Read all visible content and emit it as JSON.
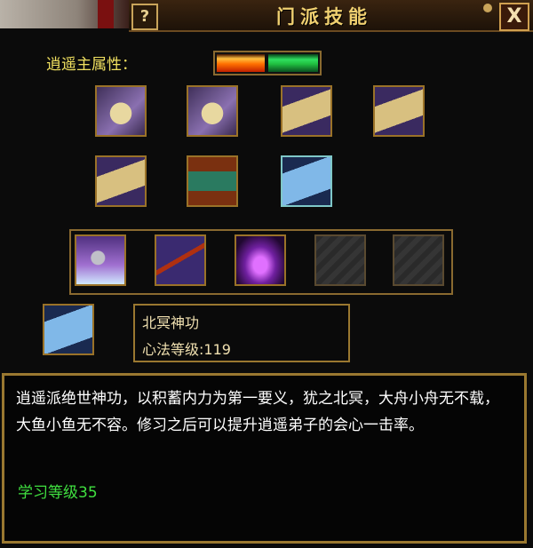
{
  "window": {
    "title": "门派技能",
    "help_label": "?",
    "close_label": "X"
  },
  "attribute": {
    "label": "逍遥主属性："
  },
  "skills_row1": [
    {
      "name": "skill-book-1",
      "type": "book"
    },
    {
      "name": "skill-book-2",
      "type": "book"
    },
    {
      "name": "skill-scroll-bamboo",
      "type": "scroll"
    },
    {
      "name": "skill-scroll-4",
      "type": "scroll"
    }
  ],
  "skills_row2": [
    {
      "name": "skill-scroll-5",
      "type": "scroll"
    },
    {
      "name": "skill-chest",
      "type": "chest"
    },
    {
      "name": "skill-blue-scroll",
      "type": "bluescroll",
      "selected": true
    }
  ],
  "skills_row3": [
    {
      "name": "martial-skill-wave",
      "type": "wave"
    },
    {
      "name": "martial-skill-spear",
      "type": "spear"
    },
    {
      "name": "martial-skill-purple",
      "type": "purple"
    },
    {
      "name": "martial-skill-locked-1",
      "type": "locked"
    },
    {
      "name": "martial-skill-locked-2",
      "type": "locked"
    }
  ],
  "detail": {
    "name": "北冥神功",
    "level_text": "心法等级:119"
  },
  "description": {
    "text": "逍遥派绝世神功，以积蓄内力为第一要义，犹之北冥，大舟小舟无不载，大鱼小鱼无不容。修习之后可以提升逍遥弟子的会心一击率。",
    "requirement": "学习等级35"
  },
  "colors": {
    "title": "#f0d070",
    "label_yellow": "#f0e060",
    "requirement_green": "#40e040",
    "frame_gold": "#9a7830"
  }
}
